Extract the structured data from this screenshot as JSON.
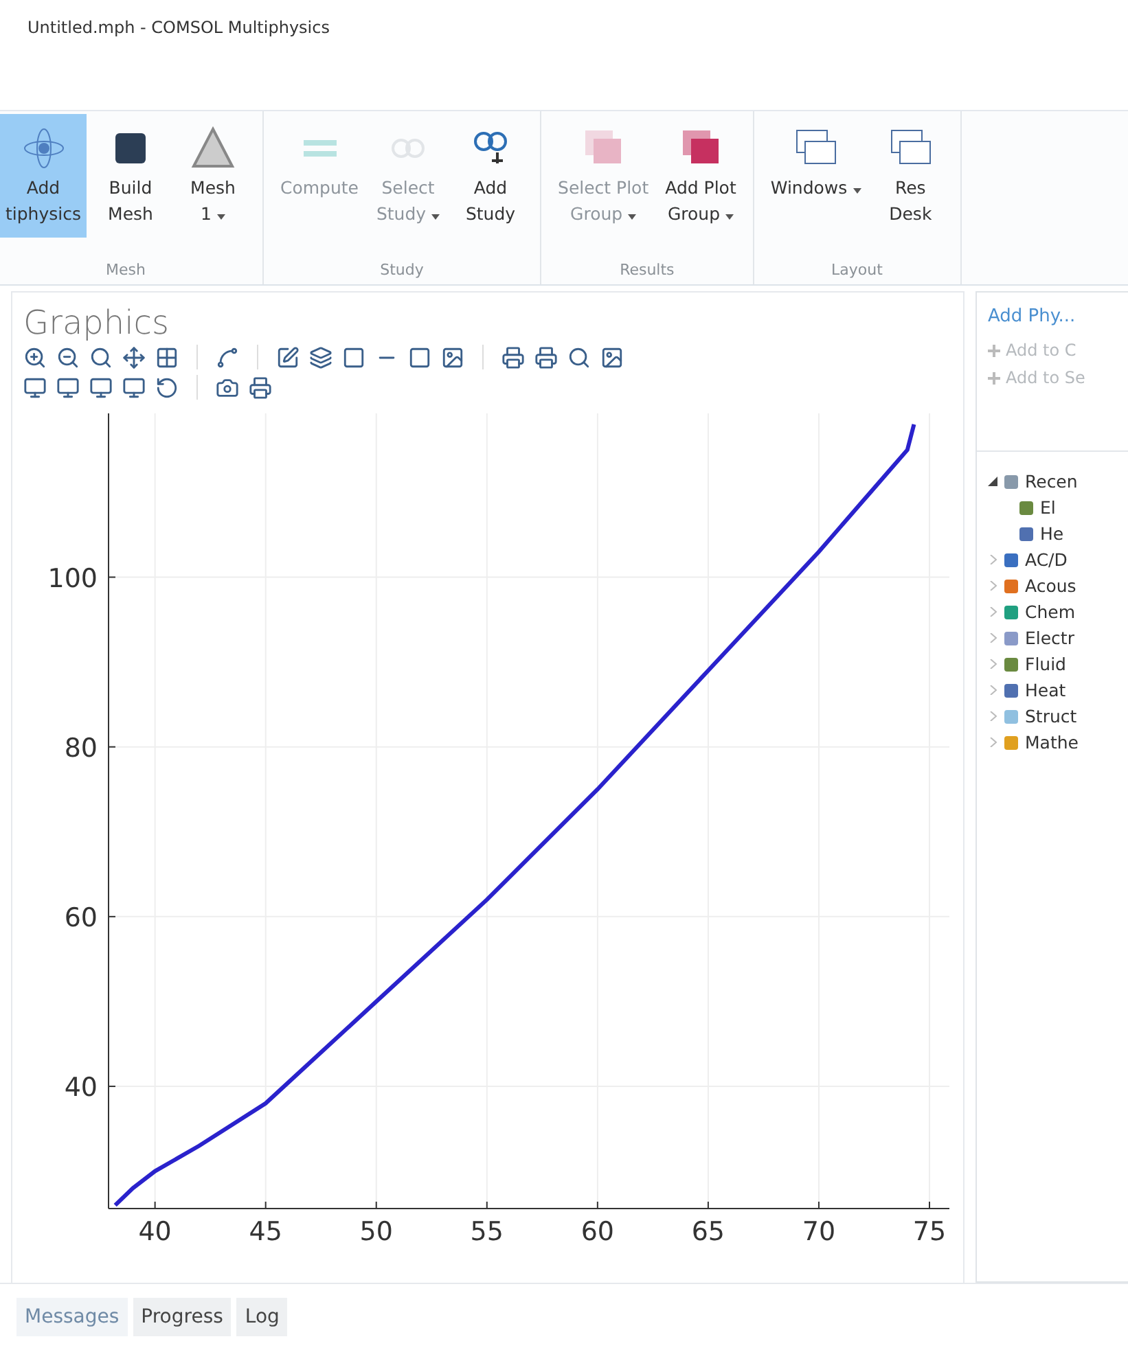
{
  "window": {
    "title": "Untitled.mph - COMSOL Multiphysics"
  },
  "ribbon": {
    "groups": [
      {
        "label": "Mesh",
        "buttons": [
          {
            "lines": [
              "Add",
              "tiphysics"
            ],
            "kind": "atom",
            "selected": true,
            "disabled": false,
            "dropdown": false
          },
          {
            "lines": [
              "Build",
              "Mesh"
            ],
            "kind": "cube",
            "selected": false,
            "disabled": false,
            "dropdown": false
          },
          {
            "lines": [
              "Mesh",
              "1"
            ],
            "kind": "triangle",
            "selected": false,
            "disabled": false,
            "dropdown": true
          }
        ]
      },
      {
        "label": "Study",
        "buttons": [
          {
            "lines": [
              "Compute"
            ],
            "kind": "equal",
            "selected": false,
            "disabled": true,
            "dropdown": false
          },
          {
            "lines": [
              "Select",
              "Study"
            ],
            "kind": "links",
            "selected": false,
            "disabled": true,
            "dropdown": true
          },
          {
            "lines": [
              "Add",
              "Study"
            ],
            "kind": "linksadd",
            "selected": false,
            "disabled": false,
            "dropdown": false
          }
        ]
      },
      {
        "label": "Results",
        "buttons": [
          {
            "lines": [
              "Select Plot",
              "Group"
            ],
            "kind": "stack",
            "selected": false,
            "disabled": true,
            "dropdown": true
          },
          {
            "lines": [
              "Add Plot",
              "Group"
            ],
            "kind": "stack",
            "selected": false,
            "disabled": false,
            "dropdown": true
          }
        ]
      },
      {
        "label": "Layout",
        "buttons": [
          {
            "lines": [
              "Windows"
            ],
            "kind": "windows",
            "selected": false,
            "disabled": false,
            "dropdown": true
          },
          {
            "lines": [
              "Res",
              "Desk"
            ],
            "kind": "window",
            "selected": false,
            "disabled": false,
            "dropdown": false
          }
        ]
      }
    ]
  },
  "graphics": {
    "title": "Graphics",
    "chart_data": {
      "type": "line",
      "grid": true,
      "xlim": [
        37.9,
        75.9
      ],
      "ylim": [
        25.6,
        119.3
      ],
      "xticks": [
        40,
        45,
        50,
        55,
        60,
        65,
        70,
        75
      ],
      "yticks": [
        40,
        60,
        80,
        100
      ],
      "x": [
        38.2,
        39,
        40,
        42,
        45,
        50,
        55,
        60,
        65,
        70,
        71,
        72,
        73,
        74,
        74.3
      ],
      "series": [
        {
          "color": "#2a22cc",
          "values": [
            26,
            28,
            30,
            33,
            38,
            50,
            62,
            75,
            89,
            103,
            106,
            109,
            112,
            115,
            118
          ]
        }
      ]
    }
  },
  "add_physics": {
    "title": "Add Phy...",
    "actions": [
      {
        "label": "Add to C",
        "disabled": true
      },
      {
        "label": "Add to Se",
        "disabled": true
      }
    ],
    "tree": [
      {
        "label": "Recen",
        "expanded": true,
        "children": [
          {
            "label": "El"
          },
          {
            "label": "He"
          }
        ]
      },
      {
        "label": "AC/D",
        "expanded": false
      },
      {
        "label": "Acous",
        "expanded": false
      },
      {
        "label": "Chem",
        "expanded": false
      },
      {
        "label": "Electr",
        "expanded": false
      },
      {
        "label": "Fluid",
        "expanded": false
      },
      {
        "label": "Heat",
        "expanded": false
      },
      {
        "label": "Struct",
        "expanded": false
      },
      {
        "label": "Mathe",
        "expanded": false
      }
    ]
  },
  "bottom_tabs": [
    {
      "label": "Messages",
      "selected": true
    },
    {
      "label": "Progress",
      "selected": false
    },
    {
      "label": "Log",
      "selected": false
    }
  ]
}
